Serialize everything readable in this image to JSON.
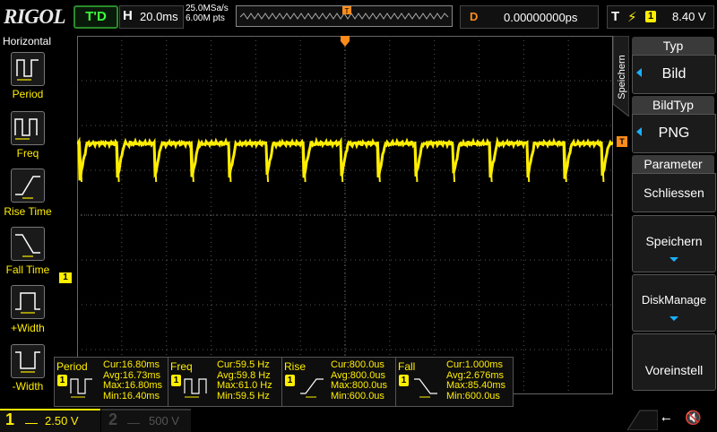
{
  "header": {
    "logo": "RIGOL",
    "trigger_status": "T'D",
    "timebase_label": "H",
    "timebase": "20.0ms",
    "sample_rate": "25.0MSa/s",
    "memory_depth": "6.00M pts",
    "trigger_marker": "T",
    "trigger_position_label": "D",
    "trigger_position": "0.00000000ps",
    "trigger_label": "T",
    "trigger_source": "1",
    "trigger_level": "8.40 V",
    "colors": {
      "channel1": "#ffee00",
      "trigger": "#ff8c1a",
      "accent": "#19b0ff",
      "status": "#3cff3c"
    }
  },
  "left_panel": {
    "title": "Horizontal",
    "items": [
      {
        "label": "Period",
        "icon": "period-icon"
      },
      {
        "label": "Freq",
        "icon": "freq-icon"
      },
      {
        "label": "Rise Time",
        "icon": "rise-time-icon"
      },
      {
        "label": "Fall Time",
        "icon": "fall-time-icon"
      },
      {
        "label": "+Width",
        "icon": "pos-width-icon"
      },
      {
        "label": "-Width",
        "icon": "neg-width-icon"
      }
    ]
  },
  "waveform": {
    "channel_marker": "1",
    "trigger_level_marker": "T"
  },
  "right_menu": {
    "tab_label": "Speichern",
    "items": [
      {
        "header": "Typ",
        "value": "Bild"
      },
      {
        "header": "BildTyp",
        "value": "PNG"
      },
      {
        "header": "Parameter",
        "value": "Schliessen"
      },
      {
        "label": "Speichern"
      },
      {
        "label": "DiskManage"
      },
      {
        "label": "Voreinstell"
      }
    ]
  },
  "measurements": [
    {
      "name": "Period",
      "channel": "1",
      "cur": "Cur:16.80ms",
      "avg": "Avg:16.73ms",
      "max": "Max:16.80ms",
      "min": "Min:16.40ms"
    },
    {
      "name": "Freq",
      "channel": "1",
      "cur": "Cur:59.5 Hz",
      "avg": "Avg:59.8 Hz",
      "max": "Max:61.0 Hz",
      "min": "Min:59.5 Hz"
    },
    {
      "name": "Rise",
      "channel": "1",
      "cur": "Cur:800.0us",
      "avg": "Avg:800.0us",
      "max": "Max:800.0us",
      "min": "Min:600.0us"
    },
    {
      "name": "Fall",
      "channel": "1",
      "cur": "Cur:1.000ms",
      "avg": "Avg:2.676ms",
      "max": "Max:85.40ms",
      "min": "Min:600.0us"
    }
  ],
  "footer": {
    "ch1_num": "1",
    "ch1_scale": "2.50 V",
    "ch2_num": "2",
    "ch2_scale": "500 V"
  }
}
